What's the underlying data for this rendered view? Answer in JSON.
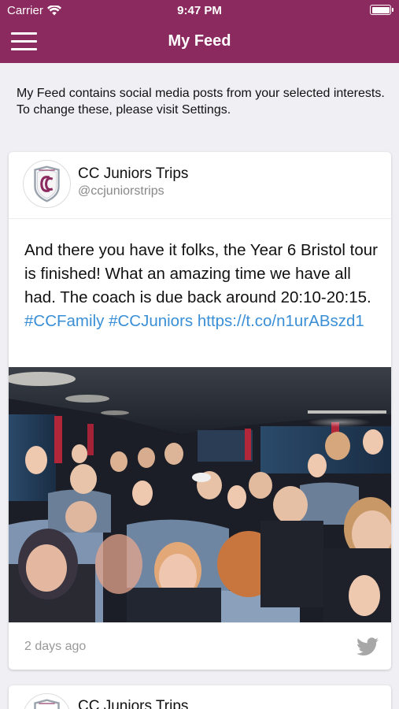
{
  "status_bar": {
    "carrier": "Carrier",
    "time": "9:47 PM"
  },
  "nav": {
    "title": "My Feed"
  },
  "intro": "My Feed contains social media posts from your selected interests. To change these, please visit Settings.",
  "posts": [
    {
      "author": "CC Juniors Trips",
      "handle": "@ccjuniorstrips",
      "text_plain": "And there you have it folks, the Year 6 Bristol tour is finished! What an amazing time we have all had. The coach is due back around 20:10-20:15. ",
      "text_link": "#CCFamily #CCJuniors https://t.co/n1urABszd1",
      "time": "2 days ago"
    },
    {
      "author": "CC Juniors Trips"
    }
  ],
  "colors": {
    "brand": "#8b2a5f",
    "link": "#3a8fd6",
    "background": "#f0eff4"
  },
  "icons": [
    "wifi-icon",
    "battery-icon",
    "menu-icon",
    "club-logo-icon",
    "twitter-icon"
  ]
}
